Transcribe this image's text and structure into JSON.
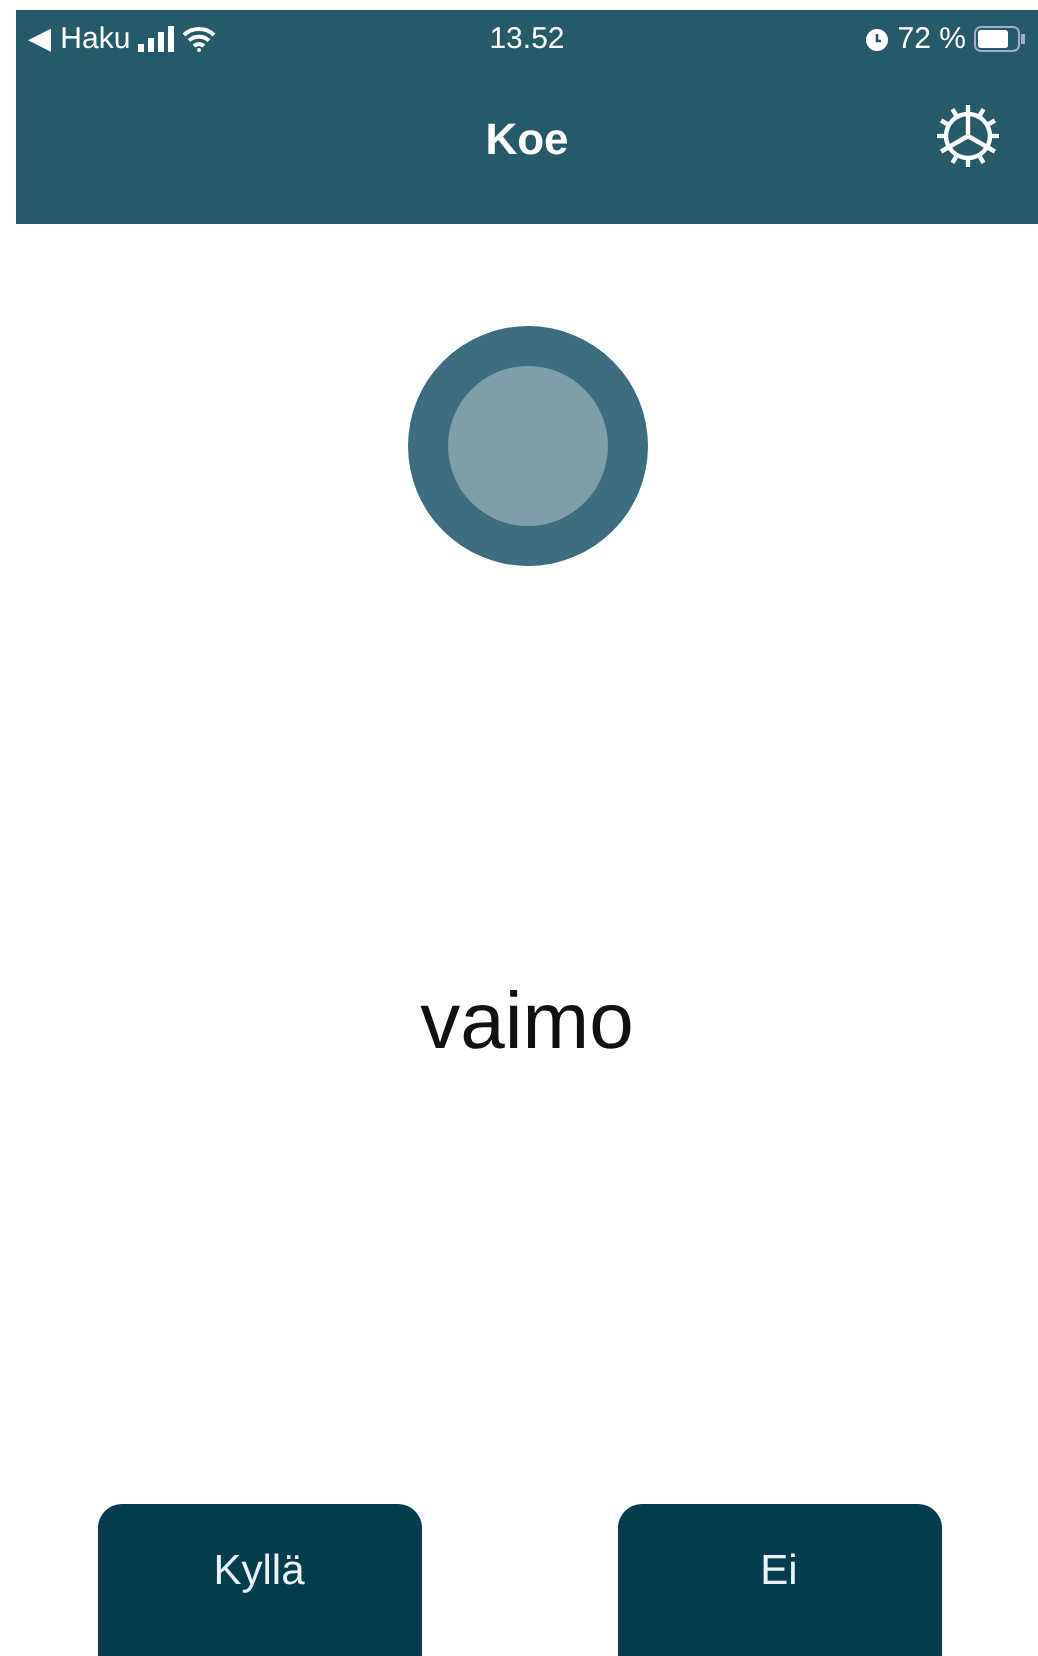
{
  "status_bar": {
    "back_label": "◀ Haku",
    "time": "13.52",
    "battery": "72 %"
  },
  "nav_bar": {
    "title": "Koe"
  },
  "word": "vaimo",
  "buttons": [
    {
      "label": "Kyllä"
    },
    {
      "label": "Ei"
    }
  ]
}
